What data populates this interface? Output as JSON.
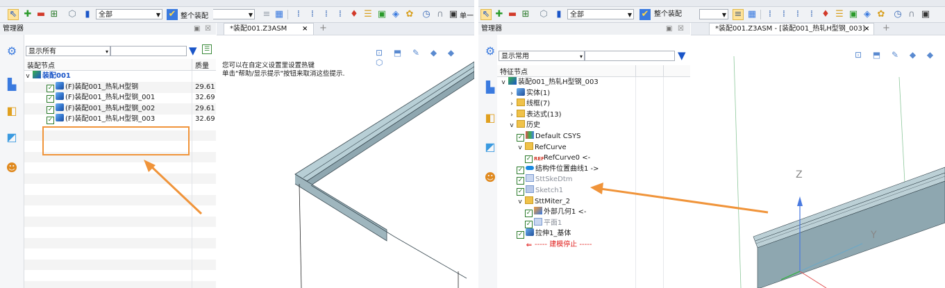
{
  "left": {
    "combo_all": "全部",
    "combo_assembly": "整个装配",
    "combo_single": "单一",
    "manager_title": "管理器",
    "tab_label": "*装配001.Z3ASM",
    "tab_close": "×",
    "tab_add": "+",
    "filter_select": "显示所有",
    "col_node": "装配节点",
    "col_mass": "质量",
    "root": "装配001",
    "items": [
      {
        "label": "(F)装配001_热轧H型钢",
        "mass": "29.61"
      },
      {
        "label": "(F)装配001_热轧H型钢_001",
        "mass": "32.69"
      },
      {
        "label": "(F)装配001_热轧H型钢_002",
        "mass": "29.61"
      },
      {
        "label": "(F)装配001_热轧H型钢_003",
        "mass": "32.69"
      }
    ],
    "hint_line1": "您可以在自定义设置里设置热键",
    "hint_line2": "单击\"帮助/显示提示\"按钮来取消这些提示."
  },
  "right": {
    "combo_all": "全部",
    "combo_assembly": "整个装配",
    "manager_title": "管理器",
    "tab_label": "*装配001.Z3ASM - [装配001_热轧H型钢_003]",
    "tab_close": "×",
    "tab_add": "+",
    "filter_select": "显示常用",
    "col_node": "特征节点",
    "tree": [
      {
        "label": "装配001_热轧H型钢_003",
        "indent": 0,
        "caret": "v",
        "icon": "asm"
      },
      {
        "label": "实体(1)",
        "indent": 1,
        "caret": ">",
        "icon": "cube"
      },
      {
        "label": "线框(7)",
        "indent": 1,
        "caret": ">",
        "icon": "folder"
      },
      {
        "label": "表达式(13)",
        "indent": 1,
        "caret": ">",
        "icon": "folder"
      },
      {
        "label": "历史",
        "indent": 1,
        "caret": "v",
        "icon": "folder"
      },
      {
        "label": "Default CSYS",
        "indent": 2,
        "check": true,
        "icon": "csys"
      },
      {
        "label": "RefCurve",
        "indent": 2,
        "caret": "v",
        "icon": "folder"
      },
      {
        "label": "RefCurve0 <-",
        "indent": 3,
        "check": true,
        "icon": "ref"
      },
      {
        "label": "结构件位置曲线1 ->",
        "indent": 2,
        "check": true,
        "icon": "curve"
      },
      {
        "label": "SttSkeDtm",
        "indent": 2,
        "check": true,
        "icon": "plane",
        "gray": true
      },
      {
        "label": "Sketch1",
        "indent": 2,
        "check": true,
        "icon": "sketch",
        "gray": true
      },
      {
        "label": "SttMiter_2",
        "indent": 2,
        "caret": "v",
        "icon": "folder"
      },
      {
        "label": "外部几何1 <-",
        "indent": 3,
        "check": true,
        "icon": "ext"
      },
      {
        "label": "平面1",
        "indent": 3,
        "check": true,
        "icon": "plane",
        "gray": true
      },
      {
        "label": "拉伸1_基体",
        "indent": 2,
        "check": true,
        "icon": "cube"
      },
      {
        "label": "----- 建模停止 -----",
        "indent": 2,
        "icon": "stop",
        "red": true
      }
    ],
    "axis_z": "Z",
    "axis_y": "Y"
  },
  "colors": {
    "accent_orange": "#f0943a",
    "tree_blue": "#1a55c8",
    "stop_red": "#e0201e"
  }
}
